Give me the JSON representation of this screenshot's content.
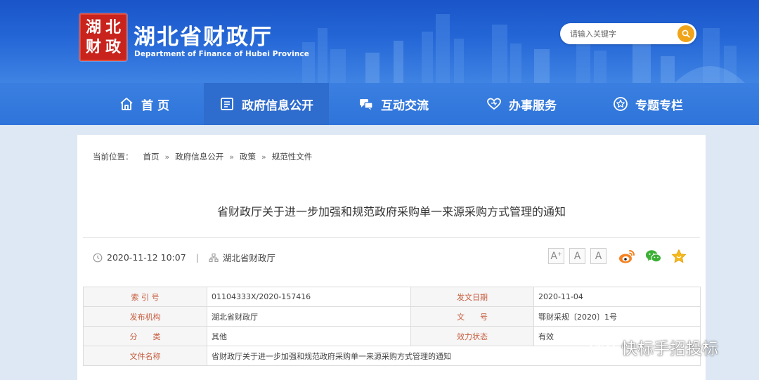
{
  "header": {
    "seal_chars": [
      "湖",
      "北",
      "财",
      "政"
    ],
    "site_name": "湖北省财政厅",
    "site_name_en": "Department of Finance of Hubei Province",
    "search_placeholder": "请输入关键字",
    "search_icon": "search-icon"
  },
  "nav": {
    "items": [
      {
        "label": "首 页",
        "icon": "home-icon"
      },
      {
        "label": "政府信息公开",
        "icon": "document-list-icon"
      },
      {
        "label": "互动交流",
        "icon": "chat-icon"
      },
      {
        "label": "办事服务",
        "icon": "heart-icon"
      },
      {
        "label": "专题专栏",
        "icon": "star-circle-icon"
      }
    ],
    "active_index": 1
  },
  "breadcrumb": {
    "prefix": "当前位置：",
    "items": [
      "首页",
      "政府信息公开",
      "政策",
      "规范性文件"
    ],
    "separator": "»"
  },
  "article": {
    "title": "省财政厅关于进一步加强和规范政府采购单一来源采购方式管理的通知",
    "datetime": "2020-11-12 10:07",
    "divider": "|",
    "source": "湖北省财政厅"
  },
  "tools": {
    "font_large": "A",
    "font_large_sup": "+",
    "font_medium": "A",
    "font_small": "A",
    "share_icons": [
      "weibo-icon",
      "wechat-icon",
      "favorite-star-icon"
    ]
  },
  "info_table": {
    "rows": [
      {
        "label1": "索 引 号",
        "value1": "01104333X/2020-157416",
        "label2": "发文日期",
        "value2": "2020-11-04"
      },
      {
        "label1": "发布机构",
        "value1": "湖北省财政厅",
        "label2": "文　　号",
        "value2": "鄂财采规〔2020〕1号"
      },
      {
        "label1": "分　　类",
        "value1": "其他",
        "label2": "效力状态",
        "value2": "有效"
      },
      {
        "label1": "文件名称",
        "value1": "省财政厅关于进一步加强和规范政府采购单一来源采购方式管理的通知",
        "label2": "",
        "value2": ""
      }
    ]
  },
  "watermark": {
    "text": "快标手招投标",
    "icon": "wechat-channel-icon"
  },
  "colors": {
    "header_blue": "#2466d6",
    "nav_blue": "#3a7fe0",
    "seal_red": "#c8231c",
    "search_orange": "#f0a419",
    "label_color": "#c65b3d",
    "weibo_orange": "#f58220",
    "wechat_green": "#3cb034",
    "star_gold": "#f5b91c"
  }
}
